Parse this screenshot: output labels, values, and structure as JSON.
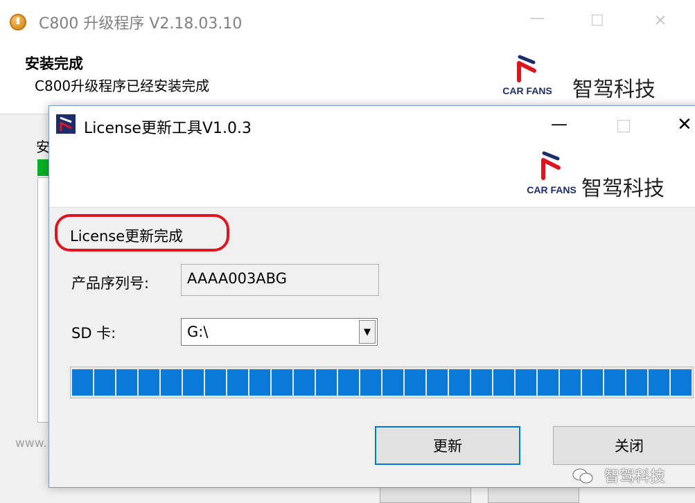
{
  "back_window": {
    "title": "C800 升级程序 V2.18.03.10",
    "heading": "安装完成",
    "subheading": "C800升级程序已经安装完成",
    "brand_logo_text": "CAR FANS",
    "brand_name": "智驾科技",
    "body_label": "安",
    "footer_text": "www.",
    "icon": "app-icon"
  },
  "dialog": {
    "title": "License更新工具V1.0.3",
    "brand_logo_text": "CAR FANS",
    "brand_name": "智驾科技",
    "status_text": "License更新完成",
    "serial_label": "产品序列号:",
    "serial_value": "AAAA003ABG",
    "sd_label": "SD 卡:",
    "sd_value": "G:\\",
    "progress_percent": 100,
    "update_button": "更新",
    "close_button": "关闭"
  },
  "watermark": {
    "text": "智驾科技"
  },
  "colors": {
    "progress_blue": "#0a7ad8",
    "status_highlight": "#e0141e",
    "back_progress_green": "#06b025",
    "logo_red": "#e0141e",
    "logo_navy": "#1d2d6b"
  }
}
